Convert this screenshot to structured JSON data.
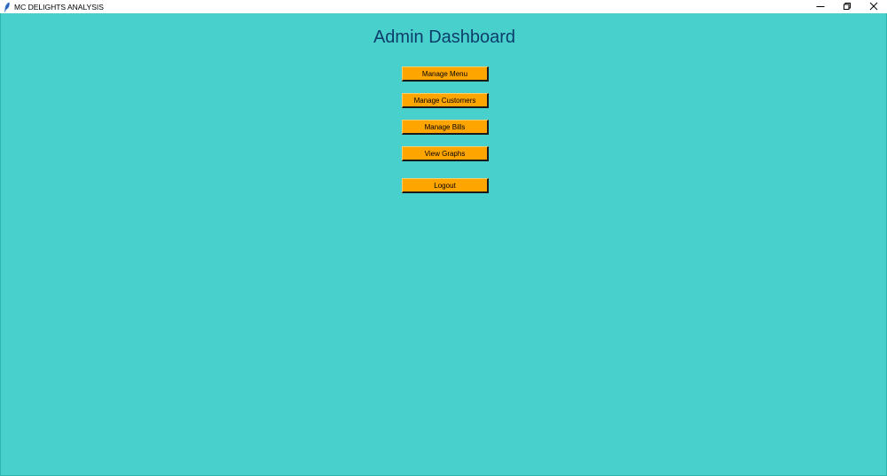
{
  "window": {
    "title": "MC DELIGHTS ANALYSIS",
    "icon": "feather-icon",
    "controls": [
      "minimize-icon",
      "restore-icon",
      "close-icon"
    ]
  },
  "dashboard": {
    "title": "Admin Dashboard",
    "buttons": {
      "manage_menu": "Manage Menu",
      "manage_customers": "Manage Customers",
      "manage_bills": "Manage Bills",
      "view_graphs": "View Graphs",
      "logout": "Logout"
    }
  },
  "colors": {
    "background": "#48d1cc",
    "button": "#ffa500",
    "title_text": "#0d3d6b"
  }
}
